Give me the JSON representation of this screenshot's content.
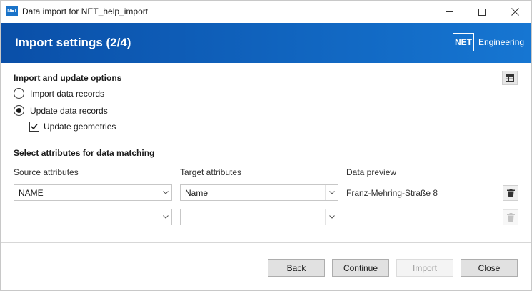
{
  "window": {
    "title": "Data import for NET_help_import",
    "app_icon_text": "NET"
  },
  "banner": {
    "title": "Import settings (2/4)",
    "brand_logo": "NET",
    "brand_text": "Engineering",
    "gradient_colors": [
      "#0a4fa8",
      "#1676d2"
    ]
  },
  "import_options": {
    "heading": "Import and update options",
    "radios": [
      {
        "label": "Import data records",
        "checked": false
      },
      {
        "label": "Update data records",
        "checked": true
      }
    ],
    "checkbox": {
      "label": "Update geometries",
      "checked": true
    },
    "table_view_icon": "table-icon"
  },
  "matching": {
    "heading": "Select attributes for data matching",
    "columns": {
      "source": "Source attributes",
      "target": "Target attributes",
      "preview": "Data preview"
    },
    "rows": [
      {
        "source": "NAME",
        "target": "Name",
        "preview": "Franz-Mehring-Straße 8",
        "delete_enabled": true
      },
      {
        "source": "",
        "target": "",
        "preview": "",
        "delete_enabled": false
      }
    ]
  },
  "footer": {
    "back": "Back",
    "continue": "Continue",
    "import": "Import",
    "import_enabled": false,
    "close": "Close"
  }
}
